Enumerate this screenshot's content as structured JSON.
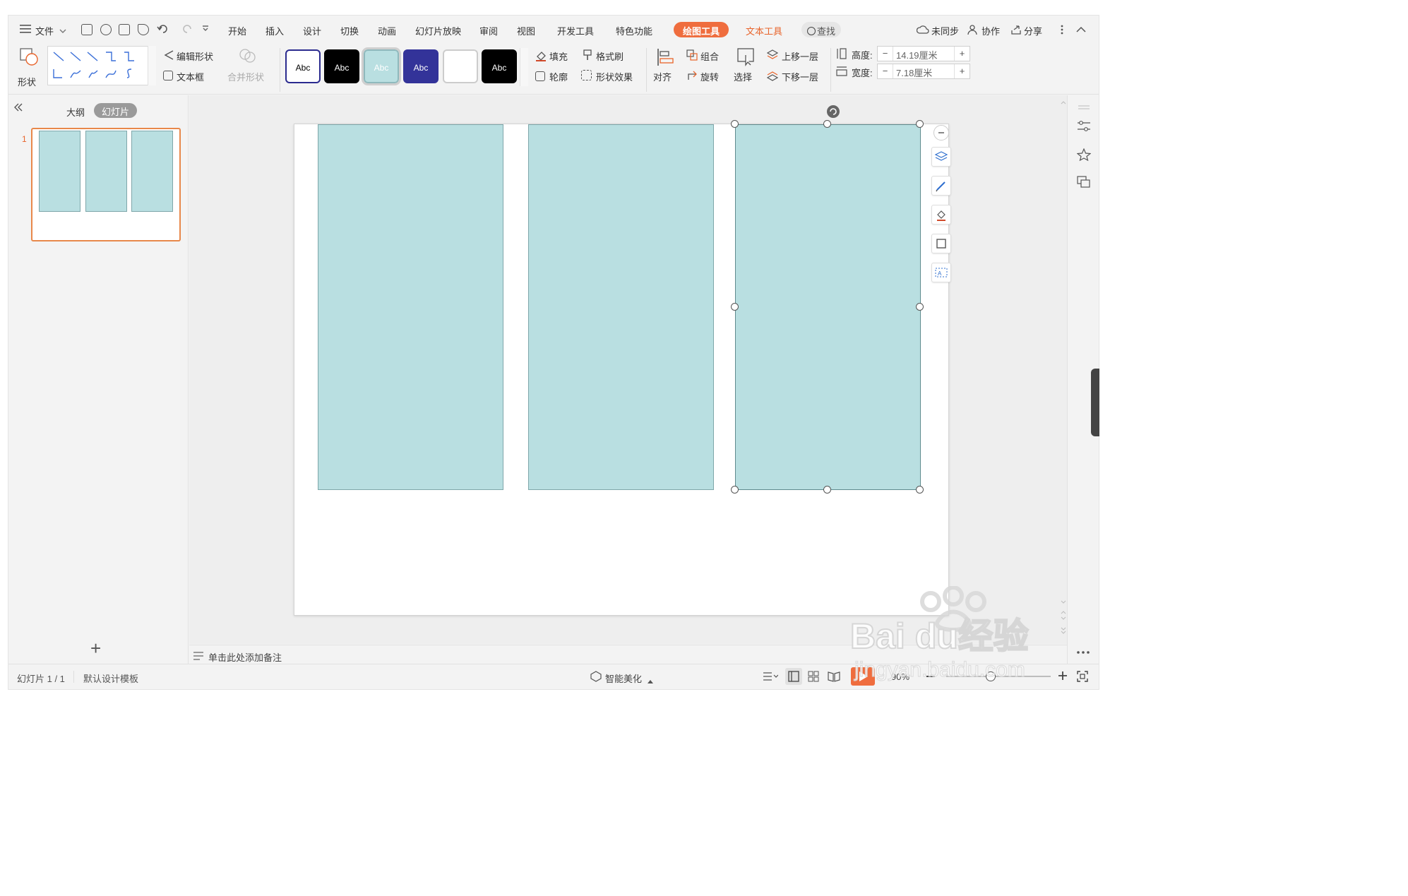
{
  "menu": {
    "file": "文件",
    "tabs": [
      "开始",
      "插入",
      "设计",
      "切换",
      "动画",
      "幻灯片放映",
      "审阅",
      "视图",
      "开发工具",
      "特色功能"
    ],
    "drawing_tools": "绘图工具",
    "text_tools": "文本工具",
    "search": "查找",
    "unsynced": "未同步",
    "collaborate": "协作",
    "share": "分享"
  },
  "ribbon": {
    "shapes": "形状",
    "edit_shape": "编辑形状",
    "text_box": "文本框",
    "merge_shapes": "合并形状",
    "style_swatches": [
      {
        "label": "Abc",
        "bg": "#ffffff",
        "fg": "#000000",
        "border": "#2b2b8f"
      },
      {
        "label": "Abc",
        "bg": "#000000",
        "fg": "#ffffff",
        "border": "#000000"
      },
      {
        "label": "Abc",
        "bg": "#b9dfe1",
        "fg": "#ffffff",
        "border": "#8fb9bd"
      },
      {
        "label": "Abc",
        "bg": "#333399",
        "fg": "#ffffff",
        "border": "#333399"
      },
      {
        "label": "",
        "bg": "#ffffff",
        "fg": "#000000",
        "border": "#cccccc"
      },
      {
        "label": "Abc",
        "bg": "#000000",
        "fg": "#ffffff",
        "border": "#000000"
      }
    ],
    "fill": "填充",
    "format_painter": "格式刷",
    "outline": "轮廓",
    "shape_effects": "形状效果",
    "align": "对齐",
    "group": "组合",
    "rotate": "旋转",
    "select": "选择",
    "bring_forward": "上移一层",
    "send_backward": "下移一层",
    "height_label": "高度:",
    "height_value": "14.19厘米",
    "width_label": "宽度:",
    "width_value": "7.18厘米",
    "minus": "−",
    "plus": "+"
  },
  "left_pane": {
    "outline_tab": "大纲",
    "slides_tab": "幻灯片",
    "slide_number": "1",
    "add_slide": "+"
  },
  "notes_placeholder": "单击此处添加备注",
  "status": {
    "slide_counter": "幻灯片 1 / 1",
    "template": "默认设计模板",
    "smart_beautify": "智能美化",
    "zoom": "90%"
  },
  "watermark": "Baidu经验 jingyan.baidu.com",
  "colors": {
    "accent": "#ef6d3e",
    "shape_fill": "#b9dfe1",
    "shape_border": "#7fa7aa",
    "selection_frame": "#e8884a"
  }
}
